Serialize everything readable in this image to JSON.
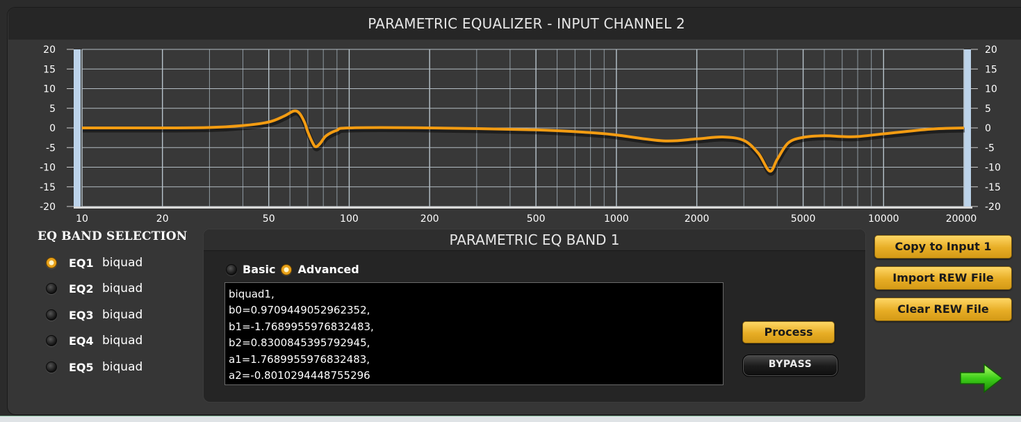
{
  "window": {
    "title": "PARAMETRIC EQUALIZER - INPUT CHANNEL 2"
  },
  "graph": {
    "y_ticks": [
      "20",
      "15",
      "10",
      "5",
      "0",
      "-5",
      "-10",
      "-15",
      "-20"
    ],
    "x_ticks": [
      "10",
      "20",
      "50",
      "100",
      "200",
      "500",
      "1000",
      "2000",
      "5000",
      "10000",
      "20000"
    ],
    "curve_color": "#f39c12",
    "ylim": [
      -20,
      20
    ],
    "xlim": [
      10,
      20000
    ]
  },
  "chart_data": {
    "type": "line",
    "x_scale": "log",
    "xlim": [
      10,
      20000
    ],
    "ylim": [
      -20,
      20
    ],
    "grid": true,
    "series": [
      {
        "values": [
          [
            10,
            0
          ],
          [
            20,
            0
          ],
          [
            30,
            0.1
          ],
          [
            40,
            0.6
          ],
          [
            50,
            1.5
          ],
          [
            57,
            3.0
          ],
          [
            62,
            4.3
          ],
          [
            65,
            3.8
          ],
          [
            68,
            1.5
          ],
          [
            70,
            -1
          ],
          [
            73,
            -3.8
          ],
          [
            75,
            -4.8
          ],
          [
            78,
            -3.9
          ],
          [
            82,
            -2
          ],
          [
            90,
            -0.6
          ],
          [
            100,
            0
          ],
          [
            200,
            0
          ],
          [
            500,
            -0.5
          ],
          [
            800,
            -1.2
          ],
          [
            1000,
            -1.8
          ],
          [
            1500,
            -3.3
          ],
          [
            2000,
            -2.8
          ],
          [
            2500,
            -2.3
          ],
          [
            3000,
            -3.2
          ],
          [
            3400,
            -6.5
          ],
          [
            3750,
            -11
          ],
          [
            4000,
            -8
          ],
          [
            4400,
            -3.8
          ],
          [
            5000,
            -2.4
          ],
          [
            6000,
            -2.0
          ],
          [
            7000,
            -2.2
          ],
          [
            8000,
            -2.2
          ],
          [
            10000,
            -1.5
          ],
          [
            15000,
            -0.3
          ],
          [
            20000,
            0
          ]
        ]
      }
    ]
  },
  "bands": {
    "heading": "EQ BAND SELECTION",
    "items": [
      {
        "id": "EQ1",
        "type": "biquad",
        "selected": true
      },
      {
        "id": "EQ2",
        "type": "biquad",
        "selected": false
      },
      {
        "id": "EQ3",
        "type": "biquad",
        "selected": false
      },
      {
        "id": "EQ4",
        "type": "biquad",
        "selected": false
      },
      {
        "id": "EQ5",
        "type": "biquad",
        "selected": false
      }
    ]
  },
  "panel": {
    "title": "PARAMETRIC EQ BAND 1",
    "mode_basic": "Basic",
    "mode_advanced": "Advanced",
    "selected_mode": "Advanced",
    "coefficients": "biquad1,\nb0=0.9709449052962352,\nb1=-1.7689955976832483,\nb2=0.8300845395792945,\na1=1.7689955976832483,\na2=-0.8010294448755296",
    "process_label": "Process",
    "bypass_label": "BYPASS"
  },
  "actions": {
    "copy_label": "Copy to Input 1",
    "import_label": "Import REW File",
    "clear_label": "Clear REW File"
  },
  "icons": {
    "next": "arrow-right-icon"
  },
  "colors": {
    "accent": "#e7ad25",
    "background": "#363636",
    "panel": "#252525"
  }
}
